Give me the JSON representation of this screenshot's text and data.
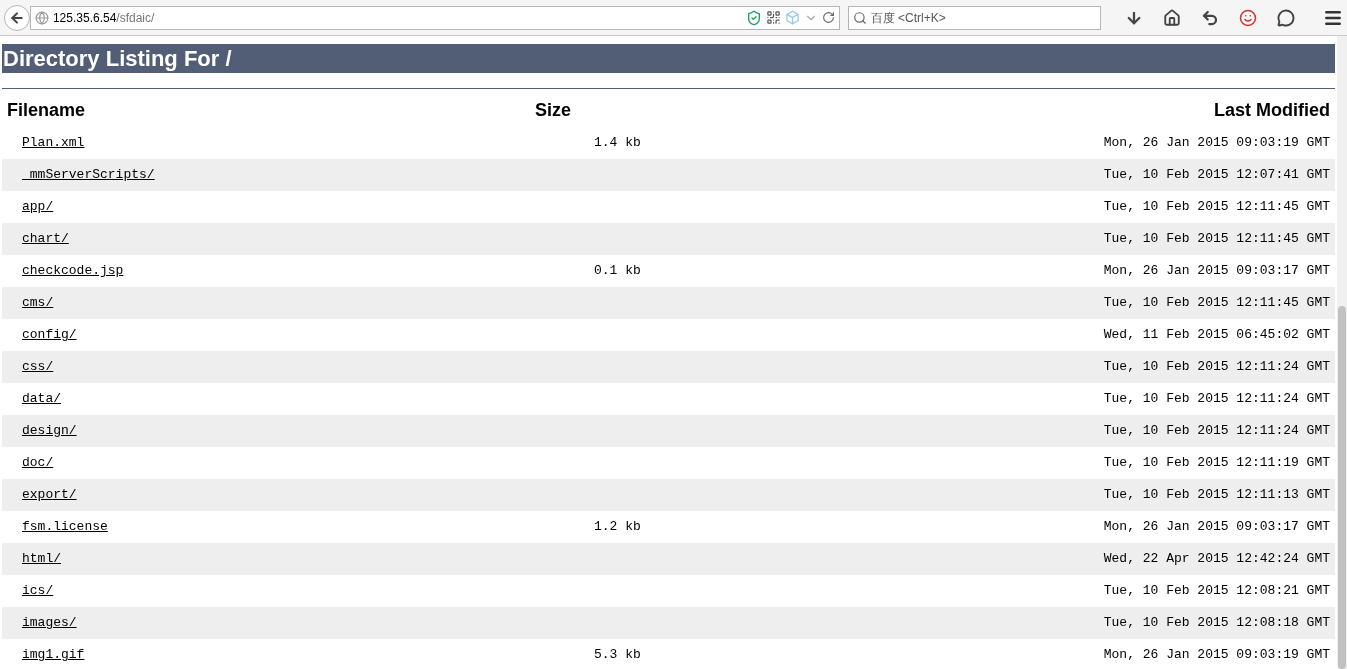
{
  "browser": {
    "url_host": "125.35.6.54",
    "url_path": "/sfdaic/",
    "search_placeholder": "百度 <Ctrl+K>"
  },
  "page": {
    "title": "Directory Listing For /",
    "columns": [
      "Filename",
      "Size",
      "Last Modified"
    ],
    "rows": [
      {
        "name": "Plan.xml",
        "size": "1.4 kb",
        "modified": "Mon, 26 Jan 2015 09:03:19 GMT"
      },
      {
        "name": "_mmServerScripts/",
        "modified": "Tue, 10 Feb 2015 12:07:41 GMT"
      },
      {
        "name": "app/",
        "modified": "Tue, 10 Feb 2015 12:11:45 GMT"
      },
      {
        "name": "chart/",
        "modified": "Tue, 10 Feb 2015 12:11:45 GMT"
      },
      {
        "name": "checkcode.jsp",
        "size": "0.1 kb",
        "modified": "Mon, 26 Jan 2015 09:03:17 GMT"
      },
      {
        "name": "cms/",
        "modified": "Tue, 10 Feb 2015 12:11:45 GMT"
      },
      {
        "name": "config/",
        "modified": "Wed, 11 Feb 2015 06:45:02 GMT"
      },
      {
        "name": "css/",
        "modified": "Tue, 10 Feb 2015 12:11:24 GMT"
      },
      {
        "name": "data/",
        "modified": "Tue, 10 Feb 2015 12:11:24 GMT"
      },
      {
        "name": "design/",
        "modified": "Tue, 10 Feb 2015 12:11:24 GMT"
      },
      {
        "name": "doc/",
        "modified": "Tue, 10 Feb 2015 12:11:19 GMT"
      },
      {
        "name": "export/",
        "modified": "Tue, 10 Feb 2015 12:11:13 GMT"
      },
      {
        "name": "fsm.license",
        "size": "1.2 kb",
        "modified": "Mon, 26 Jan 2015 09:03:17 GMT"
      },
      {
        "name": "html/",
        "modified": "Wed, 22 Apr 2015 12:42:24 GMT"
      },
      {
        "name": "ics/",
        "modified": "Tue, 10 Feb 2015 12:08:21 GMT"
      },
      {
        "name": "images/",
        "modified": "Tue, 10 Feb 2015 12:08:18 GMT"
      },
      {
        "name": "img1.gif",
        "size": "5.3 kb",
        "modified": "Mon, 26 Jan 2015 09:03:19 GMT"
      }
    ]
  }
}
